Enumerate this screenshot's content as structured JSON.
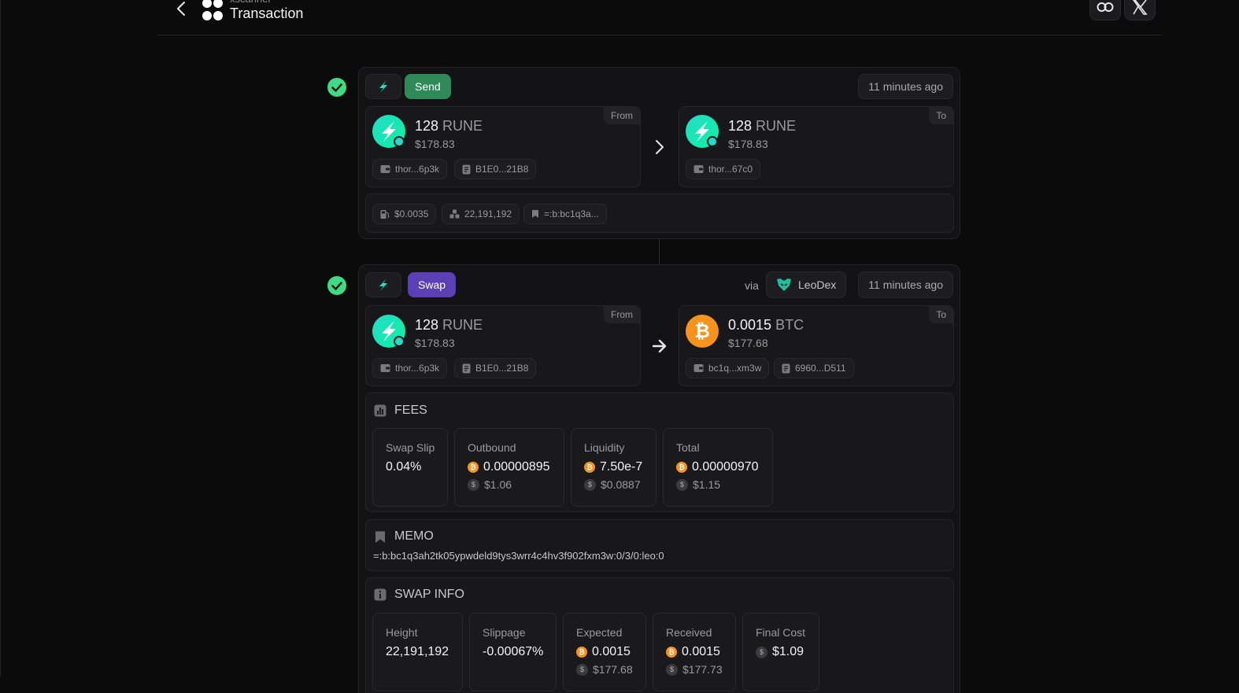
{
  "header": {
    "brand": "xscanner",
    "title": "Transaction"
  },
  "actions": [
    {
      "icon": "sign-arrow-icon",
      "amount": "128",
      "ticker": "RUNE"
    },
    {
      "icon": "swap-arrow-icon",
      "amount": "0.0015",
      "ticker": "BTC"
    }
  ],
  "send": {
    "type_label": "Send",
    "time": "11 minutes ago",
    "from_label": "From",
    "to_label": "To",
    "from": {
      "amount": "128",
      "ticker": "RUNE",
      "usd": "$178.83",
      "address": "thor...6p3k",
      "txid": "B1E0...21B8"
    },
    "to": {
      "amount": "128",
      "ticker": "RUNE",
      "usd": "$178.83",
      "address": "thor...67c0"
    },
    "meta": {
      "fee": "$0.0035",
      "height": "22,191,192",
      "memo": "=:b:bc1q3a..."
    }
  },
  "swap": {
    "type_label": "Swap",
    "via_label": "via",
    "dex": "LeoDex",
    "time": "11 minutes ago",
    "from_label": "From",
    "to_label": "To",
    "from": {
      "amount": "128",
      "ticker": "RUNE",
      "usd": "$178.83",
      "address": "thor...6p3k",
      "txid": "B1E0...21B8"
    },
    "to": {
      "amount": "0.0015",
      "ticker": "BTC",
      "usd": "$177.68",
      "address": "bc1q...xm3w",
      "txid": "6960...D511"
    }
  },
  "fees": {
    "title": "FEES",
    "swap_slip": {
      "label": "Swap Slip",
      "value": "0.04%"
    },
    "outbound": {
      "label": "Outbound",
      "value": "0.00000895",
      "usd": "$1.06"
    },
    "liquidity": {
      "label": "Liquidity",
      "value": "7.50e-7",
      "usd": "$0.0887"
    },
    "total": {
      "label": "Total",
      "value": "0.00000970",
      "usd": "$1.15"
    }
  },
  "memo": {
    "title": "MEMO",
    "text": "=:b:bc1q3ah2tk05ypwdeld9tys3wrr4c4hv3f902fxm3w:0/3/0:leo:0"
  },
  "swap_info": {
    "title": "SWAP INFO",
    "height": {
      "label": "Height",
      "value": "22,191,192"
    },
    "slippage": {
      "label": "Slippage",
      "value": "-0.00067%"
    },
    "expected": {
      "label": "Expected",
      "value": "0.0015",
      "usd": "$177.68"
    },
    "received": {
      "label": "Received",
      "value": "0.0015",
      "usd": "$177.73"
    },
    "final_cost": {
      "label": "Final Cost",
      "value": "$1.09"
    }
  },
  "colors": {
    "send_badge": "#2e8b57",
    "swap_badge": "#5b3fb5",
    "success": "#3ddc84",
    "btc": "#f7931a",
    "rune_gradient": [
      "#23dcc8",
      "#0cf2a0"
    ]
  }
}
